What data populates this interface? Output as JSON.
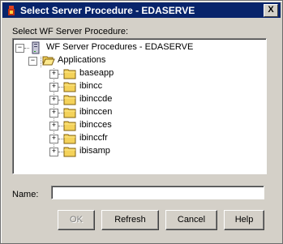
{
  "window": {
    "title": "Select Server Procedure - EDASERVE",
    "close_label": "X"
  },
  "tree": {
    "label": "Select WF Server Procedure:",
    "root": {
      "label": "WF Server Procedures - EDASERVE",
      "icon": "server-icon",
      "expander": "−"
    },
    "applications": {
      "label": "Applications",
      "icon": "open-folder-icon",
      "expander": "−"
    },
    "items": [
      {
        "label": "baseapp",
        "expander": "+"
      },
      {
        "label": "ibincc",
        "expander": "+"
      },
      {
        "label": "ibinccde",
        "expander": "+"
      },
      {
        "label": "ibinccen",
        "expander": "+"
      },
      {
        "label": "ibincces",
        "expander": "+"
      },
      {
        "label": "ibinccfr",
        "expander": "+"
      },
      {
        "label": "ibisamp",
        "expander": "+"
      }
    ]
  },
  "name_field": {
    "label": "Name:",
    "value": ""
  },
  "buttons": {
    "ok": "OK",
    "refresh": "Refresh",
    "cancel": "Cancel",
    "help": "Help"
  },
  "colors": {
    "titlebar": "#08246b",
    "folder": "#f4d25a",
    "dialog_bg": "#d4d0c8"
  }
}
